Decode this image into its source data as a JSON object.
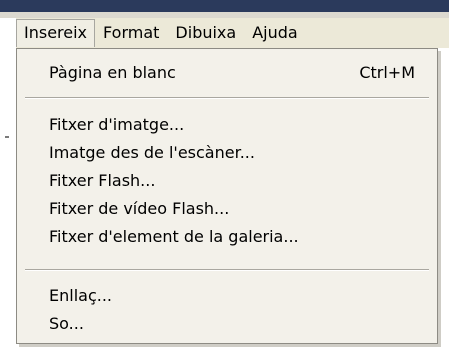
{
  "menubar": {
    "items": [
      {
        "label": "Insereix",
        "active": true
      },
      {
        "label": "Format",
        "active": false
      },
      {
        "label": "Dibuixa",
        "active": false
      },
      {
        "label": "Ajuda",
        "active": false
      }
    ]
  },
  "menu": {
    "items": [
      {
        "label": "Pàgina en blanc",
        "shortcut": "Ctrl+M"
      },
      {
        "label": "Fitxer d'imatge...",
        "shortcut": ""
      },
      {
        "label": "Imatge des de l'escàner...",
        "shortcut": ""
      },
      {
        "label": "Fitxer Flash...",
        "shortcut": ""
      },
      {
        "label": "Fitxer de vídeo Flash...",
        "shortcut": ""
      },
      {
        "label": "Fitxer d'element de la galeria...",
        "shortcut": ""
      },
      {
        "label": "Enllaç...",
        "shortcut": ""
      },
      {
        "label": "So...",
        "shortcut": ""
      }
    ]
  }
}
